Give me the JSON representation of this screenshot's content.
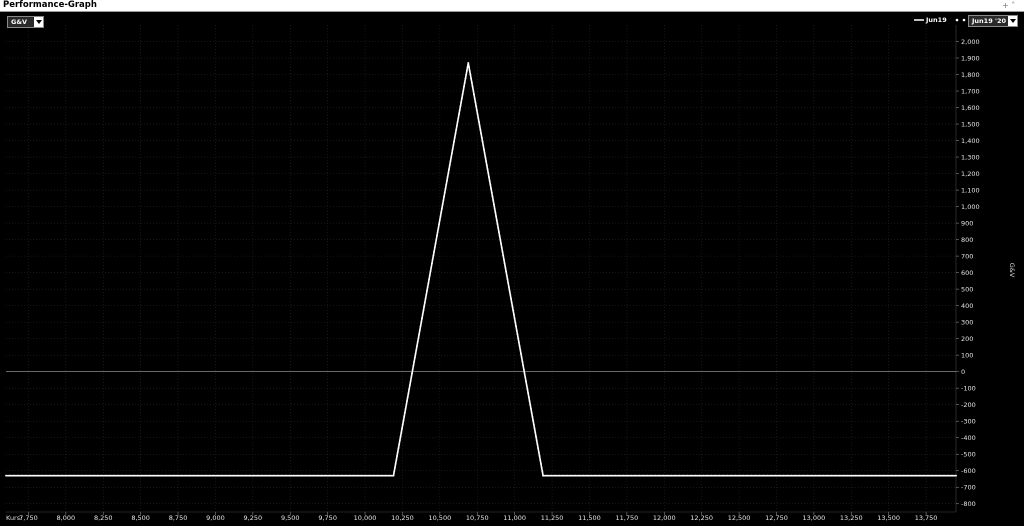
{
  "window": {
    "title": "Performance-Graph",
    "controls": "+  ˄"
  },
  "toolbar": {
    "measure_select": "G&V",
    "date_select": "Jun19 '20"
  },
  "legend": {
    "series_label": "Jun19"
  },
  "chart_data": {
    "type": "line",
    "xlabel": "Kurs:",
    "ylabel": "G&V",
    "xlim": [
      7.6,
      13.95
    ],
    "ylim": [
      -850,
      2100
    ],
    "x_ticks": [
      "7,750",
      "8,000",
      "8,250",
      "8,500",
      "8,750",
      "9,000",
      "9,250",
      "9,500",
      "9,750",
      "10,000",
      "10,250",
      "10,500",
      "10,750",
      "11,000",
      "11,250",
      "11,500",
      "11,750",
      "12,000",
      "12,250",
      "12,500",
      "12,750",
      "13,000",
      "13,250",
      "13,500",
      "13,750"
    ],
    "x_tick_values": [
      7.75,
      8.0,
      8.25,
      8.5,
      8.75,
      9.0,
      9.25,
      9.5,
      9.75,
      10.0,
      10.25,
      10.5,
      10.75,
      11.0,
      11.25,
      11.5,
      11.75,
      12.0,
      12.25,
      12.5,
      12.75,
      13.0,
      13.25,
      13.5,
      13.75
    ],
    "y_ticks": [
      "2,000",
      "1,900",
      "1,800",
      "1,700",
      "1,600",
      "1,500",
      "1,400",
      "1,300",
      "1,200",
      "1,100",
      "1,000",
      "900",
      "800",
      "700",
      "600",
      "500",
      "400",
      "300",
      "200",
      "100",
      "0",
      "-100",
      "-200",
      "-300",
      "-400",
      "-500",
      "-600",
      "-700",
      "-800"
    ],
    "y_tick_values": [
      2000,
      1900,
      1800,
      1700,
      1600,
      1500,
      1400,
      1300,
      1200,
      1100,
      1000,
      900,
      800,
      700,
      600,
      500,
      400,
      300,
      200,
      100,
      0,
      -100,
      -200,
      -300,
      -400,
      -500,
      -600,
      -700,
      -800
    ],
    "grid": true,
    "series": [
      {
        "name": "Jun19",
        "color": "#ffffff",
        "x": [
          7.6,
          10.19,
          10.69,
          11.19,
          13.95
        ],
        "y": [
          -630,
          -630,
          1870,
          -630,
          -630
        ]
      }
    ]
  }
}
